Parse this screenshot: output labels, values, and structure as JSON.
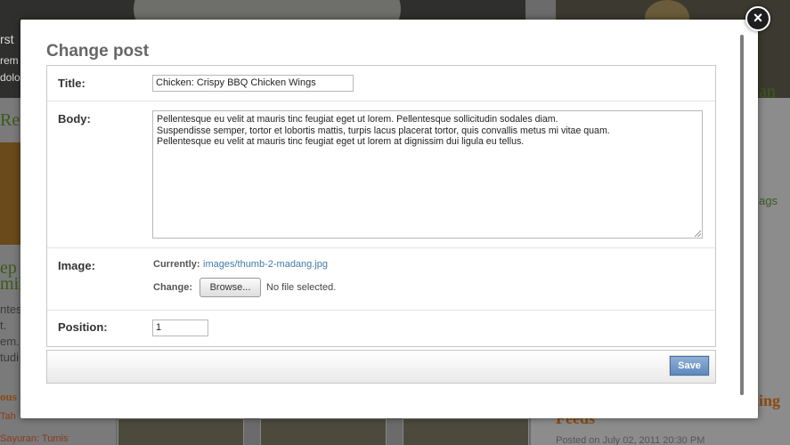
{
  "background": {
    "hero_texts": [
      "rst",
      "rem",
      "dolo"
    ],
    "left_texts": [
      "Re",
      "ep S",
      "mik",
      "ntes",
      "t.",
      "em.",
      "tudi",
      "ous",
      "Tah",
      "Sayuran: Tumis"
    ],
    "right_texts": [
      "an",
      "ags",
      "ing",
      "Feeds",
      "Posted on July 02, 2011 20:30 PM"
    ]
  },
  "modal": {
    "title": "Change post",
    "fields": {
      "title_label": "Title:",
      "title_value": "Chicken: Crispy BBQ Chicken Wings",
      "body_label": "Body:",
      "body_lines": [
        "Pellentesque eu velit at mauris tinc feugiat eget ut lorem. Pellentesque sollicitudin sodales diam.",
        "Suspendisse semper, tortor et lobortis mattis, turpis lacus placerat tortor, quis convallis metus mi vitae quam.",
        "Pellentesque eu velit at mauris tinc feugiat eget ut lorem at dignissim dui ligula eu tellus."
      ],
      "image_label": "Image:",
      "currently_label": "Currently:",
      "currently_link": "images/thumb-2-madang.jpg",
      "change_label": "Change:",
      "browse_label": "Browse...",
      "no_file_text": "No file selected.",
      "position_label": "Position:",
      "position_value": "1"
    },
    "save_label": "Save",
    "close_symbol": "×"
  },
  "colors": {
    "accent": "#447aa8",
    "save_button": "#6f96c8",
    "heading": "#666666"
  }
}
